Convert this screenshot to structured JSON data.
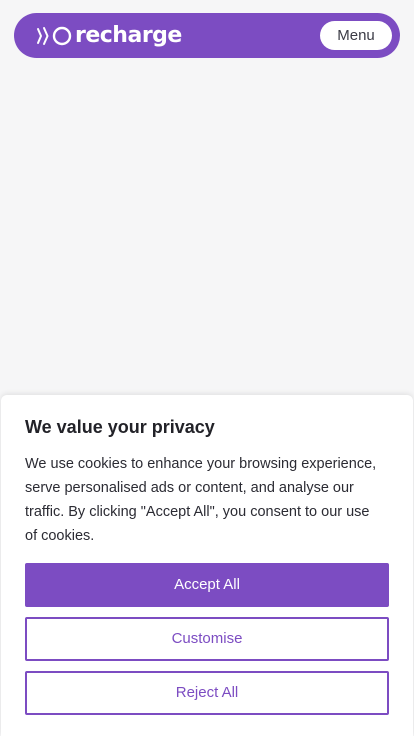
{
  "header": {
    "logo_text": "recharge",
    "logo_icon": "recharge-logo-icon",
    "menu_label": "Menu"
  },
  "cookie_banner": {
    "title": "We value your privacy",
    "text": "We use cookies to enhance your browsing experience, serve personalised ads or content, and analyse our traffic. By clicking \"Accept All\", you consent to our use of cookies.",
    "accept_label": "Accept All",
    "customise_label": "Customise",
    "reject_label": "Reject All"
  },
  "colors": {
    "brand_purple": "#7c4cc2",
    "background": "#f6f6f7",
    "white": "#ffffff"
  }
}
